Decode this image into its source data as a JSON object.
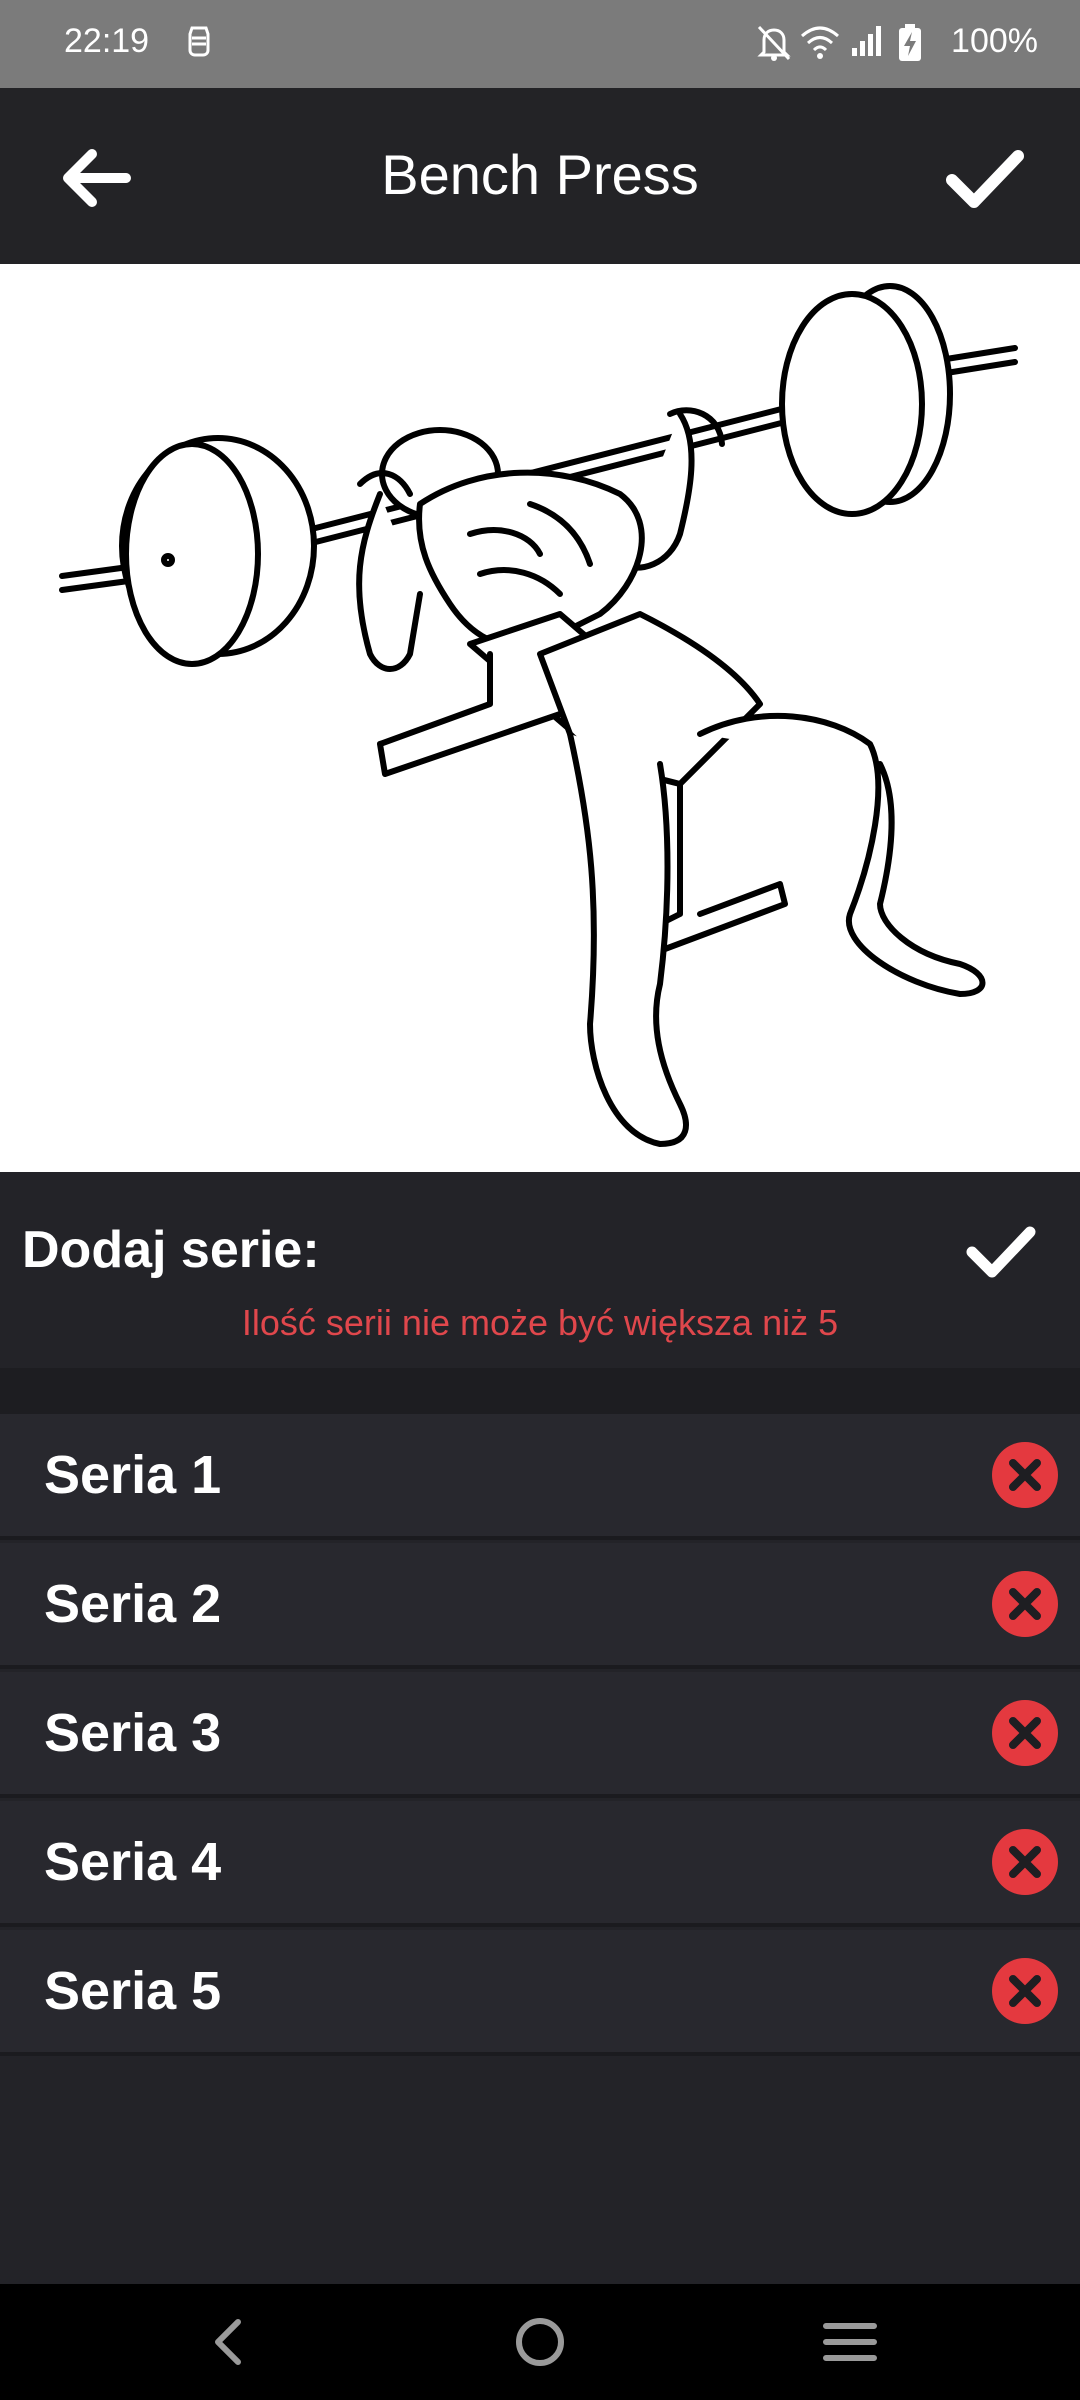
{
  "status_bar": {
    "time": "22:19",
    "battery": "100%",
    "icons": [
      "notification-icon",
      "mute-icon",
      "wifi-icon",
      "signal-icon",
      "battery-charging-icon"
    ]
  },
  "app_bar": {
    "title": "Bench Press",
    "back_icon": "arrow-left-icon",
    "confirm_icon": "check-icon"
  },
  "exercise": {
    "illustration": "bench-press-illustration"
  },
  "series_panel": {
    "title": "Dodaj serie:",
    "error": "Ilość serii nie może być większa niż 5",
    "confirm_icon": "check-icon"
  },
  "series": [
    {
      "label": "Seria 1"
    },
    {
      "label": "Seria 2"
    },
    {
      "label": "Seria 3"
    },
    {
      "label": "Seria 4"
    },
    {
      "label": "Seria 5"
    }
  ],
  "colors": {
    "background": "#232328",
    "row": "#28282e",
    "error_text": "#e0474c",
    "delete_button": "#e4393f",
    "status_bar": "#7b7b7b"
  },
  "nav_bar": {
    "buttons": [
      "back-nav-icon",
      "home-nav-icon",
      "menu-nav-icon"
    ]
  }
}
